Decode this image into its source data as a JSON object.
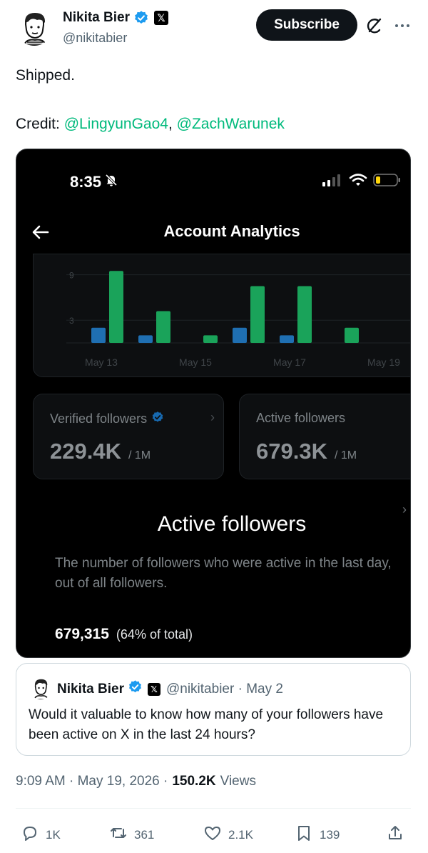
{
  "author": {
    "name": "Nikita Bier",
    "handle": "@nikitabier",
    "x_badge": "𝕏"
  },
  "header": {
    "subscribe_label": "Subscribe"
  },
  "tweet": {
    "text": "Shipped.",
    "credit_label": "Credit: ",
    "credit_mention_1": "@LingyunGao4",
    "credit_separator": ", ",
    "credit_mention_2": "@ZachWarunek"
  },
  "screenshot": {
    "status_time": "8:35",
    "nav_title": "Account Analytics",
    "chart_data": {
      "type": "bar",
      "categories": [
        "May 13",
        "",
        "May 15",
        "",
        "May 17",
        "",
        "May 19"
      ],
      "y_ticks": [
        3,
        9
      ],
      "x_tick_labels": [
        "May 13",
        "May 15",
        "May 17",
        "May 19"
      ],
      "ylim": [
        0,
        10
      ],
      "series": [
        {
          "color": "#1f6fb2",
          "values": [
            2,
            1,
            0,
            2,
            1,
            0
          ]
        },
        {
          "color": "#1aa35a",
          "values": [
            9.5,
            4.2,
            1,
            7.5,
            7.5,
            2
          ]
        }
      ]
    },
    "verified_card": {
      "label": "Verified followers",
      "value": "229.4K",
      "total": "/ 1M",
      "chevron": "›"
    },
    "active_card": {
      "label": "Active followers",
      "value": "679.3K",
      "total": "/ 1M"
    },
    "side_chevron": "›",
    "detail": {
      "title": "Active followers",
      "description": "The number of followers who were active in the last day, out of all followers.",
      "value": "679,315",
      "share": "(64% of total)"
    }
  },
  "quote": {
    "name": "Nikita Bier",
    "x_badge": "𝕏",
    "meta": "@nikitabier · May 2",
    "text": "Would it valuable to know how many of your followers have been active on X in the last 24 hours?"
  },
  "meta": {
    "timestamp": "9:09 AM · May 19, 2026 · ",
    "views_count": "150.2K",
    "views_label": "Views"
  },
  "actions": {
    "replies": "1K",
    "reposts": "361",
    "likes": "2.1K",
    "bookmarks": "139"
  },
  "colors": {
    "accent_mention": "#00ba7c",
    "verified_blue": "#1d9bf0",
    "bar_blue": "#1f6fb2",
    "bar_green": "#1aa35a"
  }
}
